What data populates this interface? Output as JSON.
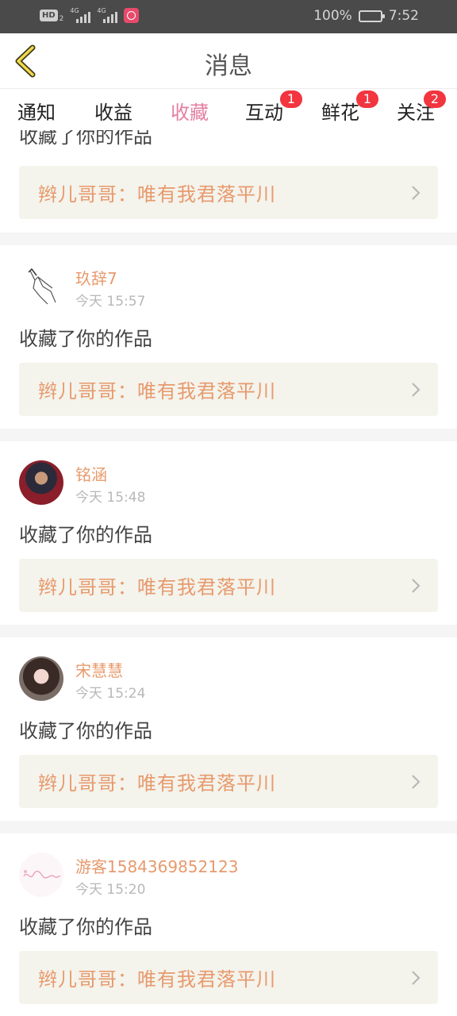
{
  "status_bar": {
    "hd": "HD",
    "hd_sub": "2",
    "network1": "4G",
    "network2": "4G",
    "battery": "100%",
    "time": "7:52"
  },
  "nav": {
    "title": "消息",
    "back_icon": "chevron-left-icon"
  },
  "tabs": [
    {
      "label": "通知",
      "active": false,
      "badge": ""
    },
    {
      "label": "收益",
      "active": false,
      "badge": ""
    },
    {
      "label": "收藏",
      "active": true,
      "badge": ""
    },
    {
      "label": "互动",
      "active": false,
      "badge": "1"
    },
    {
      "label": "鲜花",
      "active": false,
      "badge": "1"
    },
    {
      "label": "关注",
      "active": false,
      "badge": "2"
    }
  ],
  "colors": {
    "accent": "#e47fa2",
    "name": "#e79a6c",
    "badge": "#f2353f",
    "link_bg": "#f4f3ec"
  },
  "feed": {
    "partial": {
      "action": "收藏了你的作品",
      "work": "辫儿哥哥：唯有我君落平川"
    },
    "items": [
      {
        "name": "玖辞7",
        "time": "今天 15:57",
        "action": "收藏了你的作品",
        "work": "辫儿哥哥：唯有我君落平川"
      },
      {
        "name": "铭涵",
        "time": "今天 15:48",
        "action": "收藏了你的作品",
        "work": "辫儿哥哥：唯有我君落平川"
      },
      {
        "name": "宋慧慧",
        "time": "今天 15:24",
        "action": "收藏了你的作品",
        "work": "辫儿哥哥：唯有我君落平川"
      },
      {
        "name": "游客1584369852123",
        "time": "今天 15:20",
        "action": "收藏了你的作品",
        "work": "辫儿哥哥：唯有我君落平川"
      }
    ]
  }
}
